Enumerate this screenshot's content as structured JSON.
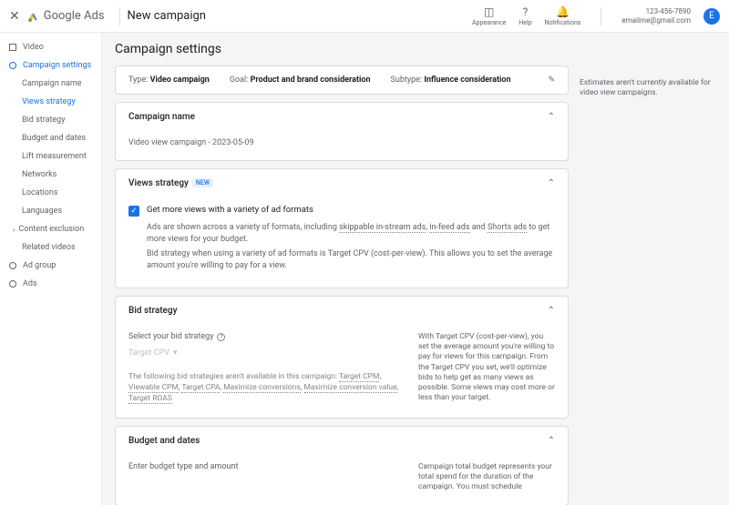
{
  "header": {
    "product": "Google Ads",
    "page_title": "New campaign",
    "icons": {
      "appearance": "Appearance",
      "help": "Help",
      "notifications": "Notifications"
    },
    "account_id": "123-456-7890",
    "account_email": "emailme@gmail.com",
    "avatar_letter": "E"
  },
  "sidebar": {
    "video": "Video",
    "campaign_settings": "Campaign settings",
    "items": {
      "campaign_name": "Campaign name",
      "views_strategy": "Views strategy",
      "bid_strategy": "Bid strategy",
      "budget_and_dates": "Budget and dates",
      "lift_measurement": "Lift measurement",
      "networks": "Networks",
      "locations": "Locations",
      "languages": "Languages",
      "content_exclusion": "Content exclusion",
      "related_videos": "Related videos"
    },
    "ad_group": "Ad group",
    "ads": "Ads"
  },
  "side_note": "Estimates aren't currently available for video view campaigns.",
  "main": {
    "heading": "Campaign settings",
    "summary": {
      "type_label": "Type:",
      "type_value": "Video campaign",
      "goal_label": "Goal:",
      "goal_value": "Product and brand consideration",
      "subtype_label": "Subtype:",
      "subtype_value": "Influence consideration"
    },
    "campaign_name": {
      "title": "Campaign name",
      "value": "Video view campaign - 2023-05-09"
    },
    "views_strategy": {
      "title": "Views strategy",
      "badge": "NEW",
      "checkbox_label": "Get more views with a variety of ad formats",
      "desc1a": "Ads are shown across a variety of formats, including ",
      "link1": "skippable in-stream ads",
      "desc1b": ", ",
      "link2": "in-feed ads",
      "desc1c": " and ",
      "link3": "Shorts ads",
      "desc1d": " to get more views for your budget.",
      "desc2": "Bid strategy when using a variety of ad formats is Target CPV (cost-per-view). This allows you to set the average amount you're willing to pay for a view."
    },
    "bid_strategy": {
      "title": "Bid strategy",
      "select_label": "Select your bid strategy",
      "selected": "Target CPV",
      "unavailable_a": "The following bid strategies aren't available in this campaign: ",
      "ua1": "Target CPM",
      "ua2": "Viewable CPM",
      "ua3": "Target CPA",
      "ua4": "Maximize conversions",
      "ua5": "Maximize conversion value",
      "ua6": "Target ROAS",
      "help": "With Target CPV (cost-per-view), you set the average amount you're willing to pay for views for this campaign. From the Target CPV you set, we'll optimize bids to help get as many views as possible. Some views may cost more or less than your target."
    },
    "budget": {
      "title": "Budget and dates",
      "enter_label": "Enter budget type and amount",
      "help": "Campaign total budget represents your total spend for the duration of the campaign. You must schedule"
    }
  }
}
